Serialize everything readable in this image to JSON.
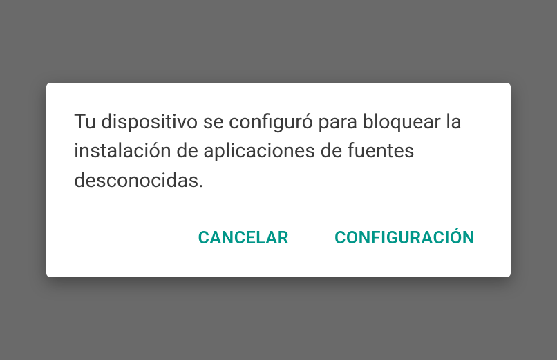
{
  "dialog": {
    "message": "Tu dispositivo se configuró para blo­quear la instalación de aplicaciones de fuentes desconocidas.",
    "buttons": {
      "cancel": "CANCELAR",
      "settings": "CONFIGURACIÓN"
    },
    "accentColor": "#009688"
  }
}
